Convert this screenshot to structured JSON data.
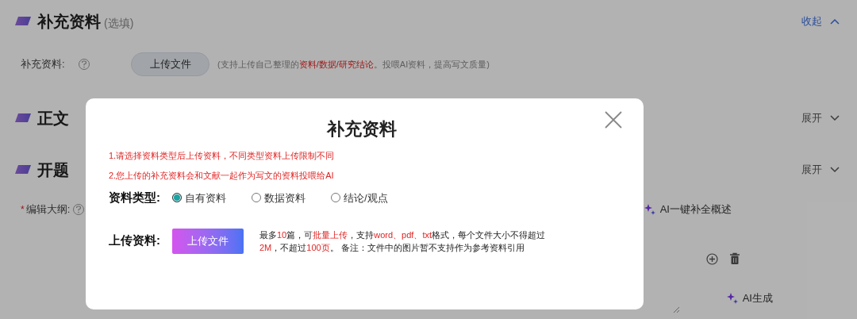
{
  "sections": [
    {
      "title": "补充资料",
      "hint": "(选填)",
      "toggle": "收起",
      "expanded": true
    },
    {
      "title": "正文",
      "toggle": "展开",
      "expanded": false
    },
    {
      "title": "开题",
      "toggle": "展开",
      "expanded": false
    }
  ],
  "supplement": {
    "label": "补充资料:",
    "button": "上传文件",
    "note": [
      {
        "text": "(支持上传自己整理的",
        "highlight": false
      },
      {
        "text": "资料/数据/研究结论",
        "highlight": true
      },
      {
        "text": "。投喂AI资料，提高写文质量)",
        "highlight": false
      }
    ]
  },
  "outline": {
    "label": "编辑大纲:",
    "required_mark": "*",
    "ai_fill": "AI一键补全概述",
    "ai_generate": "AI生成"
  },
  "modal": {
    "title": "补充资料",
    "notices": [
      "1.请选择资料类型后上传资料，不同类型资料上传限制不同",
      "2.您上传的补充资料会和文献一起作为写文的资料投喂给AI"
    ],
    "type_label": "资料类型:",
    "types": [
      {
        "label": "自有资料",
        "selected": true
      },
      {
        "label": "数据资料",
        "selected": false
      },
      {
        "label": "结论/观点",
        "selected": false
      }
    ],
    "upload_label": "上传资料:",
    "upload_button": "上传文件",
    "rules": [
      {
        "segments": [
          {
            "text": "最多",
            "highlight": false
          },
          {
            "text": "10",
            "highlight": true
          },
          {
            "text": "篇，可",
            "highlight": false
          },
          {
            "text": "批量上传",
            "highlight": true
          },
          {
            "text": "，支持",
            "highlight": false
          },
          {
            "text": "word、pdf、txt",
            "highlight": true
          },
          {
            "text": "格式，每个文件大小不得超过",
            "highlight": false
          }
        ]
      },
      {
        "segments": [
          {
            "text": "2M",
            "highlight": true
          },
          {
            "text": "，不超过",
            "highlight": false
          },
          {
            "text": "100页",
            "highlight": true
          },
          {
            "text": "。 备注：文件中的图片暂不支持作为参考资料引用",
            "highlight": false
          }
        ]
      }
    ]
  }
}
